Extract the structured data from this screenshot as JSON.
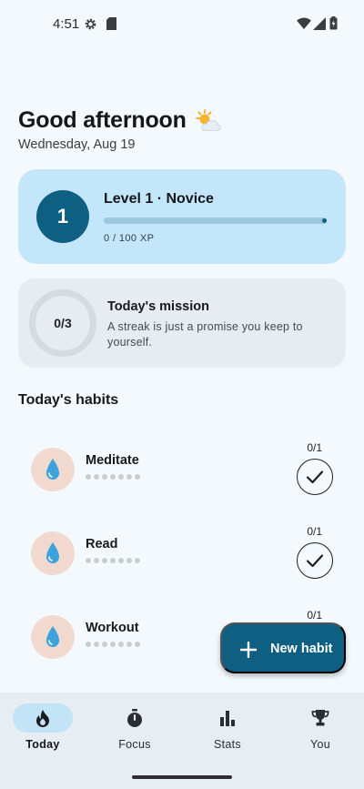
{
  "status_bar": {
    "time": "4:51"
  },
  "header": {
    "greeting": "Good afternoon",
    "greeting_icon": "sun-behind-cloud-icon",
    "date": "Wednesday, Aug 19"
  },
  "level": {
    "number": "1",
    "title": "Level 1 · Novice",
    "xp_text": "0 / 100 XP",
    "progress": 0.0
  },
  "mission": {
    "progress_text": "0/3",
    "title": "Today's mission",
    "quote": "A streak is just a promise you keep to yourself."
  },
  "habits_section": {
    "title": "Today's habits",
    "items": [
      {
        "name": "Meditate",
        "count": "0/1",
        "icon": "water-drop-icon"
      },
      {
        "name": "Read",
        "count": "0/1",
        "icon": "water-drop-icon"
      },
      {
        "name": "Workout",
        "count": "0/1",
        "icon": "water-drop-icon"
      }
    ]
  },
  "fab": {
    "label": "New habit"
  },
  "nav": {
    "items": [
      {
        "label": "Today",
        "icon": "flame-icon",
        "active": true
      },
      {
        "label": "Focus",
        "icon": "stopwatch-icon",
        "active": false
      },
      {
        "label": "Stats",
        "icon": "bar-chart-icon",
        "active": false
      },
      {
        "label": "You",
        "icon": "trophy-icon",
        "active": false
      }
    ]
  },
  "colors": {
    "primary": "#0f5f83",
    "level_card_bg": "#c3e6fb",
    "mission_card_bg": "#e6ecf1",
    "habit_icon_bg": "#f2d9cf",
    "drop_color": "#3ba3dd",
    "background": "#f4f9fd"
  }
}
